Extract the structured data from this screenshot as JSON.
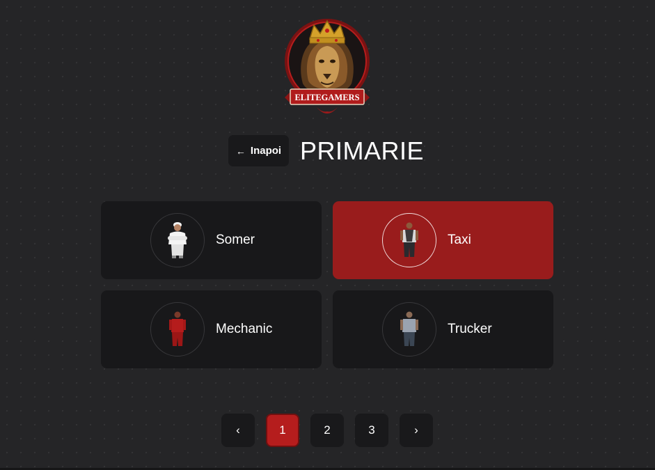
{
  "logo": {
    "text": "ELITEGAMERS"
  },
  "header": {
    "back_label": "Inapoi",
    "title": "PRIMARIE"
  },
  "jobs": [
    {
      "label": "Somer",
      "active": false
    },
    {
      "label": "Taxi",
      "active": true
    },
    {
      "label": "Mechanic",
      "active": false
    },
    {
      "label": "Trucker",
      "active": false
    }
  ],
  "pagination": {
    "prev": "‹",
    "pages": [
      "1",
      "2",
      "3"
    ],
    "current": "1",
    "next": "›"
  },
  "colors": {
    "background": "#252527",
    "card": "#18181a",
    "accent": "#991c1c",
    "page_active": "#b51d1d"
  }
}
